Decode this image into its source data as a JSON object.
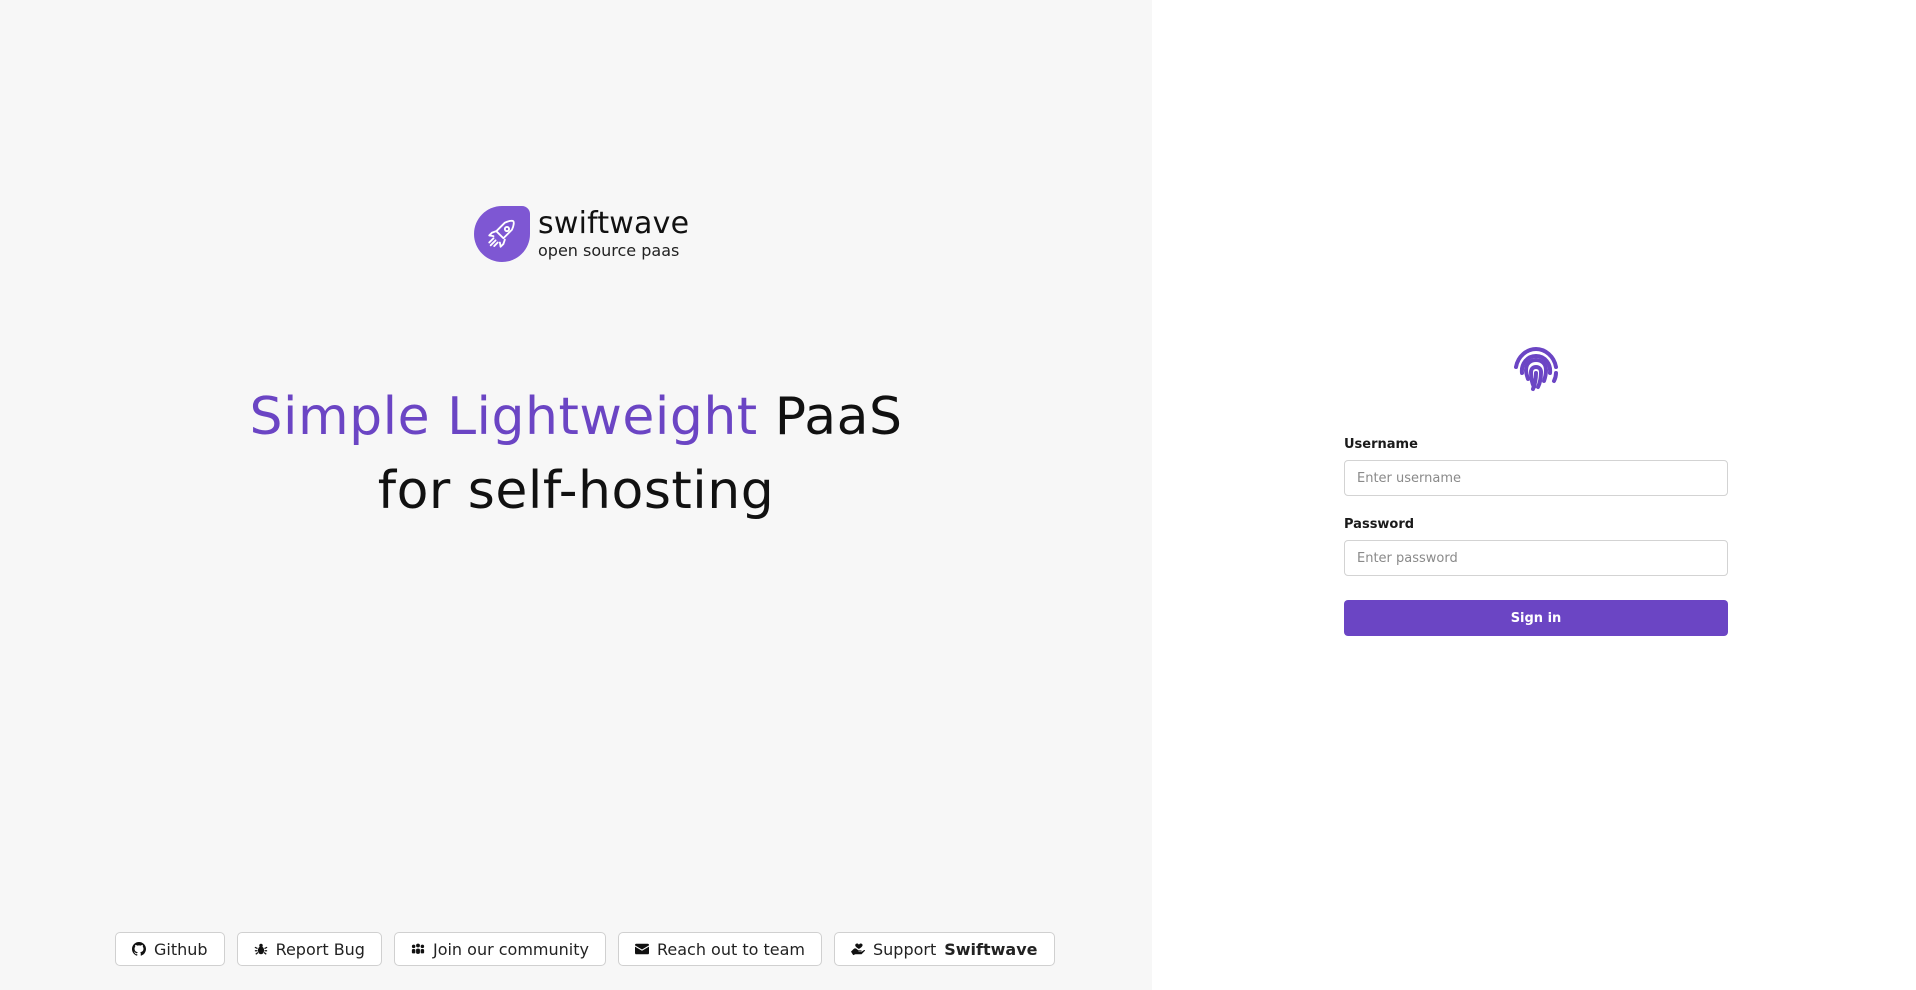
{
  "brand": {
    "name": "swiftwave",
    "tagline": "open source paas",
    "logo_icon": "rocket-icon",
    "color": "#7e57d3"
  },
  "headline": {
    "accent": "Simple Lightweight",
    "rest": "PaaS",
    "line2": "for self-hosting",
    "accent_color": "#6b45c4"
  },
  "links": [
    {
      "label": "Github",
      "icon": "github-icon"
    },
    {
      "label": "Report Bug",
      "icon": "bug-icon"
    },
    {
      "label": "Join our community",
      "icon": "users-icon"
    },
    {
      "label": "Reach out to team",
      "icon": "envelope-icon"
    },
    {
      "label_prefix": "Support",
      "label_strong": "Swiftwave",
      "icon": "heart-hand-icon"
    }
  ],
  "login": {
    "icon": "fingerprint-icon",
    "username_label": "Username",
    "username_placeholder": "Enter username",
    "password_label": "Password",
    "password_placeholder": "Enter password",
    "submit_label": "Sign in",
    "accent": "#6b45c4"
  }
}
